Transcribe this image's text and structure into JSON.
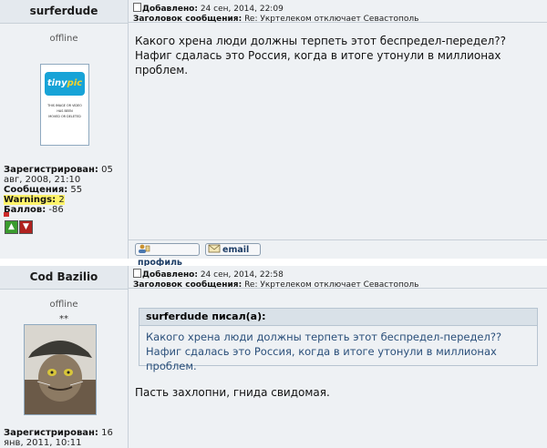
{
  "posts": [
    {
      "author": "surferdude",
      "status": "offline",
      "avatar_logo": "tinypic",
      "avatar_message": [
        "THIS IMAGE OR VIDEO",
        "HAS BEEN",
        "MOVED OR DELETED"
      ],
      "stats": {
        "registered_label": "Зарегистрирован:",
        "registered_value": "05 авг, 2008, 21:10",
        "messages_label": "Сообщения:",
        "messages_value": "55",
        "warnings_label": "Warnings:",
        "warnings_value": "2",
        "score_label": "Баллов:",
        "score_value": "-86"
      },
      "meta": {
        "added_label": "Добавлено:",
        "added_value": "24 сен, 2014, 22:09",
        "subject_label": "Заголовок сообщения:",
        "subject_value": "Re: Укртелеком отключает Севастополь"
      },
      "text": "Какого хрена люди должны терпеть этот беспредел-передел?? Нафиг сдалась это Россия, когда в итоге утонули в миллионах проблем.",
      "buttons": {
        "profile": "профиль",
        "email": "email"
      }
    },
    {
      "author": "Cod Bazilio",
      "status": "offline",
      "rank": "**",
      "stats": {
        "registered_label": "Зарегистрирован:",
        "registered_value": "16 янв, 2011, 10:11"
      },
      "meta": {
        "added_label": "Добавлено:",
        "added_value": "24 сен, 2014, 22:58",
        "subject_label": "Заголовок сообщения:",
        "subject_value": "Re: Укртелеком отключает Севастополь"
      },
      "quote": {
        "header": "surferdude писал(а):",
        "text": "Какого хрена люди должны терпеть этот беспредел-передел?? Нафиг сдалась это Россия, когда в итоге утонули в миллионах проблем."
      },
      "text": "Пасть захлопни, гнида свидомая."
    }
  ],
  "icons": {
    "karma_plus": "thumbs-up-icon",
    "karma_minus": "thumbs-down-icon",
    "post_doc": "post-document-icon"
  },
  "colors": {
    "background": "#eef1f4",
    "border": "#c8d0d8",
    "warnings_highlight": "#fff36a",
    "quote_text": "#2a4f7a"
  }
}
